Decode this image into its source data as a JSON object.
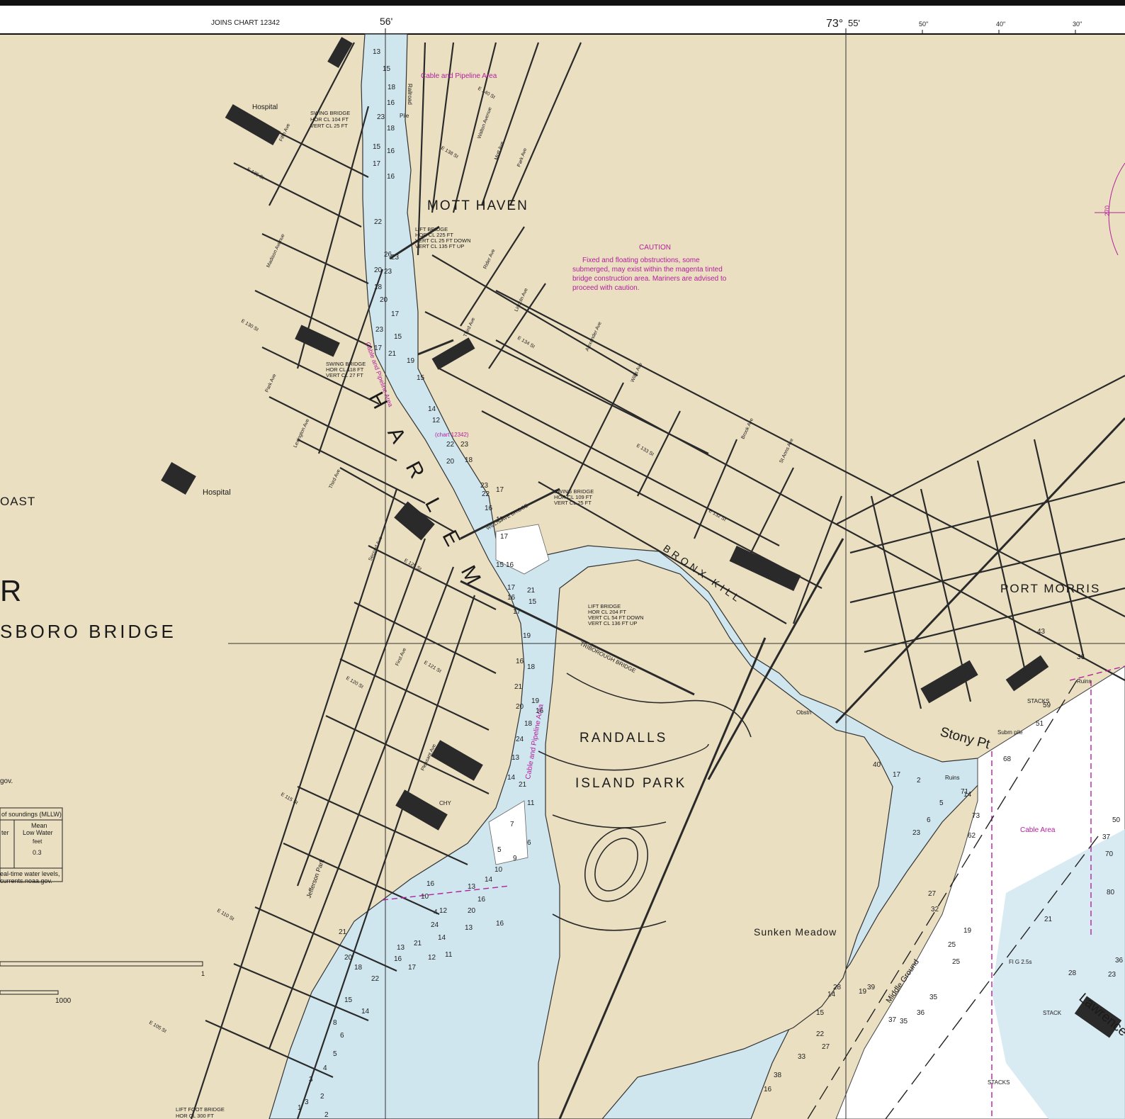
{
  "colors": {
    "land": "#ebdfc2",
    "water": "#cfe6ef",
    "deep_water": "#ffffff",
    "road": "#2a2a2a",
    "magenta": "#b2219c",
    "marsh": "#cfe0b4"
  },
  "border": {
    "joins_chart": "JOINS CHART 12342",
    "long_56": "56'",
    "long_73_degree": "73°",
    "long_55": "55'",
    "tick_50": "50\"",
    "tick_40": "40\"",
    "tick_30": "30\""
  },
  "place_names": {
    "mott_haven": "MOTT HAVEN",
    "port_morris": "PORT MORRIS",
    "randalls": "RANDALLS",
    "island_park": "ISLAND PARK",
    "sunken_meadow": "Sunken Meadow",
    "stony_pt": "Stony Pt",
    "harlem": "H A R L E M",
    "bronx_kill": "BRONX KILL",
    "hospital_1": "Hospital",
    "hospital_2": "Hospital",
    "left_r": "R",
    "left_oast": "OAST",
    "left_bridge": "SBORO BRIDGE",
    "left_gov": "gov.",
    "middle_ground": "Middle Ground",
    "lawrence": "Lawrence"
  },
  "caution": {
    "title": "CAUTION",
    "lines": [
      "Fixed  and  floating obstructions, some",
      "submerged,  may exist within the magenta tinted",
      "bridge  construction area.  Mariners are advised to",
      "proceed with caution."
    ]
  },
  "bridge_notes": {
    "swing_1": [
      "SWING BRIDGE",
      "HOR  CL  104 FT",
      "VERT  CL  25 FT"
    ],
    "lift_1": [
      "LIFT BRIDGE",
      "HOR CL 225 FT",
      "VERT CL 25 FT DOWN",
      "VERT CL 135 FT UP"
    ],
    "swing_2": [
      "SWING BRIDGE",
      "HOR CL 118 FT",
      "VERT CL 27 FT"
    ],
    "swing_3": [
      "SWING BRIDGE",
      "HOR CL 109 FT",
      "VERT CL 25 FT"
    ],
    "lift_2": [
      "LIFT BRIDGE",
      "HOR CL   204 FT",
      "VERT CL   54 FT DOWN",
      "VERT CL 136 FT UP"
    ],
    "lift_foot": [
      "LIFT FOOT BRIDGE",
      "HOR CL 300 FT"
    ]
  },
  "area_labels": {
    "cable_pipeline_1": "Cable and Pipeline Area",
    "cable_pipeline_2": "Cable and Pipeline Area",
    "cable_pipeline_3": "Cable and Pipeline Area",
    "cable_area": "Cable Area",
    "chart_ref": "(chart 12342)"
  },
  "features": {
    "triborough_bridge": "TRIBOROUGH BRIDGE",
    "willis_ave_bridge": "WILLIS AVE BRIDGE",
    "stacks_1": "STACKS",
    "stacks_2": "STACKS",
    "stack": "STACK",
    "chy": "CHY",
    "obstn": "Obstn",
    "ruins_1": "Ruins",
    "ruins_2": "Ruins",
    "subm_pile": "Subm pile",
    "jefferson_park": "Jefferson Park",
    "pile": "Pile",
    "railroad": "Railroad",
    "fl_g": "Fl G 2.5s"
  },
  "streets": {
    "e135": "E 135 St",
    "e130": "E 130 St",
    "e125": "E 125 St",
    "e121": "E 121 St",
    "e120": "E 120 St",
    "e115": "E 115 St",
    "e110": "E 110 St",
    "e105": "E 105 St",
    "e140": "E 140 St",
    "e138": "E 138 St",
    "e134": "E 134 St",
    "e133": "E 133 St",
    "e132": "E 132 St",
    "park_ave": "Park Ave",
    "madison_ave": "Madison Avenue",
    "lexington_ave": "Lexington Ave",
    "third_ave": "Third Ave",
    "second_ave": "Second Ave",
    "first_ave": "First Ave",
    "pleasant_ave": "Pleasant Ave",
    "fifth_ave": "Fifth Ave",
    "willis_ave": "Willis Ave",
    "brook_ave": "Brook Ave",
    "st_anns_ave": "St Anns Ave",
    "lincoln_ave": "Lincoln Ave",
    "alexander_ave": "Alexander Ave",
    "rider_ave": "Rider Ave",
    "walton_ave": "Walton Avenue",
    "mott_ave": "Mott Ave",
    "park_ave_bronx": "Park Ave",
    "third_ave_bronx": "Third Ave"
  },
  "tide_table": {
    "caption": "of soundings (MLLW)",
    "col_water": "ter",
    "col_mean": "Mean",
    "col_low": "Low Water",
    "unit": "feet",
    "value": "0.3",
    "note1": "eal-time water levels,",
    "note2": "currents.noaa.gov."
  },
  "scale": {
    "one": "1",
    "thousand": "1000"
  },
  "compass": {
    "label": "270"
  },
  "soundings": [
    "13",
    "15",
    "18",
    "16",
    "23",
    "18",
    "15",
    "16",
    "17",
    "16",
    "22",
    "26",
    "23",
    "20",
    "23",
    "18",
    "20",
    "17",
    "23",
    "15",
    "17",
    "21",
    "19",
    "15",
    "14",
    "12",
    "22",
    "23",
    "18",
    "20",
    "23",
    "22",
    "17",
    "16",
    "17",
    "17",
    "15",
    "16",
    "17",
    "21",
    "16",
    "15",
    "17",
    "19",
    "16",
    "18",
    "21",
    "19",
    "20",
    "16",
    "18",
    "24",
    "13",
    "14",
    "21",
    "11",
    "7",
    "6",
    "5",
    "9",
    "10",
    "14",
    "13",
    "16",
    "20",
    "16",
    "13",
    "12",
    "24",
    "14",
    "21",
    "13",
    "16",
    "17",
    "12",
    "11",
    "22",
    "21",
    "20",
    "18",
    "15",
    "14",
    "8",
    "6",
    "5",
    "4",
    "3",
    "2",
    "3",
    "2",
    "1",
    "4",
    "10",
    "16",
    "19",
    "25",
    "25",
    "35",
    "36",
    "35",
    "37",
    "32",
    "27",
    "62",
    "73",
    "71",
    "68",
    "59",
    "51",
    "43",
    "36",
    "37",
    "70",
    "80",
    "36",
    "28",
    "21",
    "23",
    "6",
    "5",
    "2",
    "17",
    "14",
    "22",
    "27",
    "33",
    "38",
    "16",
    "15",
    "14",
    "19",
    "39",
    "50",
    "40",
    "28",
    "23",
    "16",
    "58",
    "45",
    "56"
  ]
}
